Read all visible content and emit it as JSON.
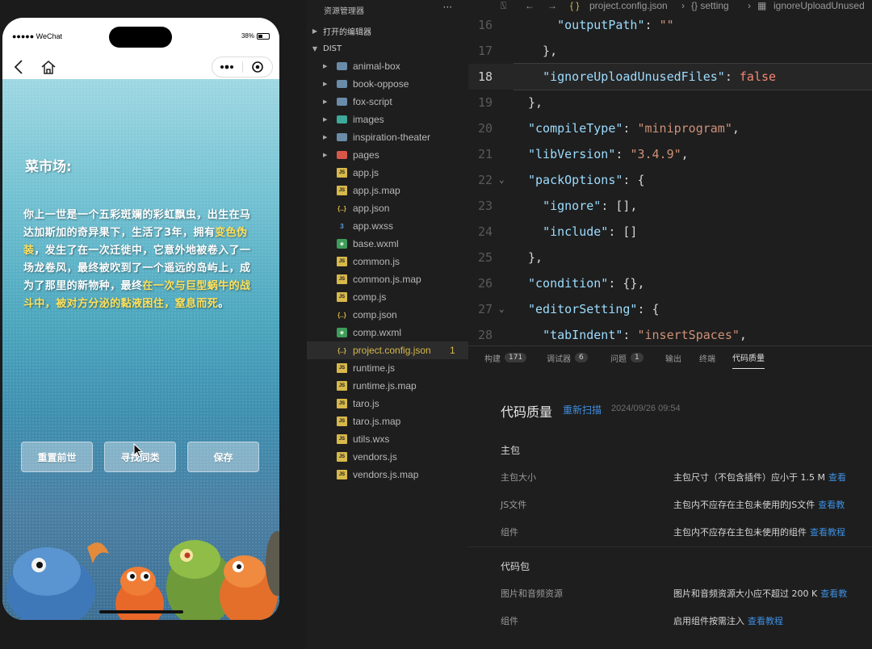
{
  "simulator": {
    "carrier": "●●●●● WeChat",
    "battery": "38%",
    "title": "菜市场:",
    "story": {
      "p1": "你上一世是一个五彩斑斓的彩虹飘虫，出生在马达加斯加的奇异果下，生活了3年，拥有",
      "h1": "变色伪装",
      "p2": "，发生了在一次迁徙中，它意外地被卷入了一场龙卷风，最终被吹到了一个遥远的岛屿上，成为了那里的新物种，最终",
      "h2": "在一次与巨型蜗牛的战斗中，被对方分泌的黏液困住，窒息而死",
      "p3": "。"
    },
    "buttons": [
      "重置前世",
      "寻找同类",
      "保存"
    ]
  },
  "explorer": {
    "title": "资源管理器",
    "more": "···",
    "open_editors": "打开的编辑器",
    "root": "DIST",
    "items": [
      {
        "name": "animal-box",
        "type": "folder"
      },
      {
        "name": "book-oppose",
        "type": "folder"
      },
      {
        "name": "fox-script",
        "type": "folder"
      },
      {
        "name": "images",
        "type": "folder"
      },
      {
        "name": "inspiration-theater",
        "type": "folder"
      },
      {
        "name": "pages",
        "type": "folder"
      },
      {
        "name": "app.js",
        "type": "js"
      },
      {
        "name": "app.js.map",
        "type": "js"
      },
      {
        "name": "app.json",
        "type": "json"
      },
      {
        "name": "app.wxss",
        "type": "wxss"
      },
      {
        "name": "base.wxml",
        "type": "wxml"
      },
      {
        "name": "common.js",
        "type": "js"
      },
      {
        "name": "common.js.map",
        "type": "js"
      },
      {
        "name": "comp.js",
        "type": "js"
      },
      {
        "name": "comp.json",
        "type": "json"
      },
      {
        "name": "comp.wxml",
        "type": "wxml"
      },
      {
        "name": "project.config.json",
        "type": "json",
        "badge": "1"
      },
      {
        "name": "runtime.js",
        "type": "js"
      },
      {
        "name": "runtime.js.map",
        "type": "js"
      },
      {
        "name": "taro.js",
        "type": "js"
      },
      {
        "name": "taro.js.map",
        "type": "js"
      },
      {
        "name": "utils.wxs",
        "type": "js"
      },
      {
        "name": "vendors.js",
        "type": "js"
      },
      {
        "name": "vendors.js.map",
        "type": "js"
      }
    ]
  },
  "editor": {
    "breadcrumb": [
      "project.config.json",
      "{} setting",
      "ignoreUploadUnused"
    ],
    "current_line": 18,
    "lines": [
      {
        "n": "16",
        "html": "    <span class='k'>\"outputPath\"</span>: <span class='s'>\"\"</span>"
      },
      {
        "n": "17",
        "html": "  },"
      },
      {
        "n": "18",
        "html": "  <span class='k'>\"ignoreUploadUnusedFiles\"</span>: <span class='f'>false</span>"
      },
      {
        "n": "19",
        "html": "},"
      },
      {
        "n": "20",
        "html": "<span class='k'>\"compileType\"</span>: <span class='s'>\"miniprogram\"</span>,"
      },
      {
        "n": "21",
        "html": "<span class='k'>\"libVersion\"</span>: <span class='s'>\"3.4.9\"</span>,"
      },
      {
        "n": "22",
        "html": "<span class='k'>\"packOptions\"</span>: {"
      },
      {
        "n": "23",
        "html": "  <span class='k'>\"ignore\"</span>: [],"
      },
      {
        "n": "24",
        "html": "  <span class='k'>\"include\"</span>: []"
      },
      {
        "n": "25",
        "html": "},"
      },
      {
        "n": "26",
        "html": "<span class='k'>\"condition\"</span>: {},"
      },
      {
        "n": "27",
        "html": "<span class='k'>\"editorSetting\"</span>: {"
      },
      {
        "n": "28",
        "html": "  <span class='k'>\"tabIndent\"</span>: <span class='s'>\"insertSpaces\"</span>,"
      }
    ]
  },
  "panel": {
    "tabs": [
      {
        "label": "构建",
        "count": "171"
      },
      {
        "label": "调试器",
        "count": "6"
      },
      {
        "label": "问题",
        "count": "1"
      },
      {
        "label": "输出",
        "count": ""
      },
      {
        "label": "终端",
        "count": ""
      },
      {
        "label": "代码质量",
        "count": "",
        "active": true
      }
    ],
    "title": "代码质量",
    "rescan": "重新扫描",
    "timestamp": "2024/09/26 09:54",
    "groups": [
      {
        "name": "主包",
        "rows": [
          {
            "label": "主包大小",
            "desc": "主包尺寸（不包含插件）应小于 1.5 M",
            "link": "查看"
          },
          {
            "label": "JS文件",
            "desc": "主包内不应存在主包未使用的JS文件",
            "link": "查看教"
          },
          {
            "label": "组件",
            "desc": "主包内不应存在主包未使用的组件",
            "link": "查看教程"
          }
        ]
      },
      {
        "name": "代码包",
        "rows": [
          {
            "label": "图片和音频资源",
            "desc": "图片和音频资源大小应不超过 200 K",
            "link": "查看教"
          },
          {
            "label": "组件",
            "desc": "启用组件按需注入",
            "link": "查看教程"
          }
        ]
      }
    ]
  },
  "colors": {
    "accent_link": "#3d8fe0",
    "modified_file": "#d7b84a",
    "highlight_text": "#ffe15a"
  }
}
